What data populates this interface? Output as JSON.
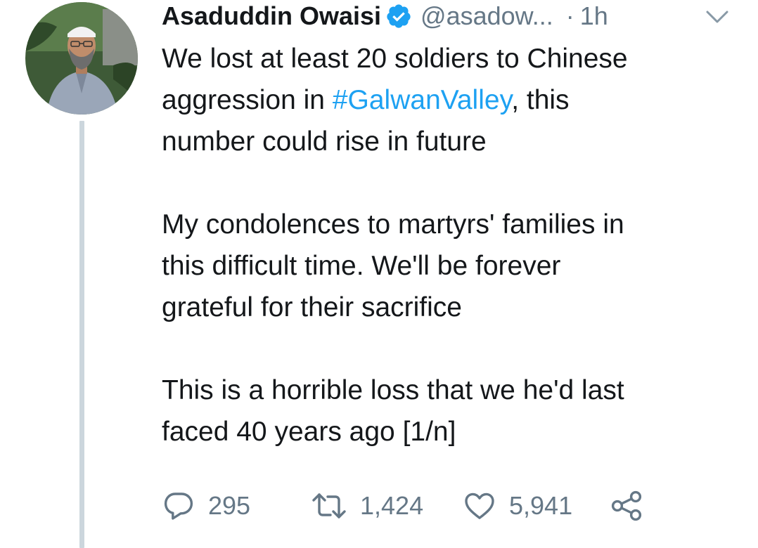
{
  "tweet": {
    "author_name": "Asaduddin Owaisi",
    "handle": "@asadow...",
    "separator": "·",
    "time": "1h",
    "text": {
      "line1": "We lost at least 20 soldiers to Chinese",
      "line2_before": "aggression in ",
      "hashtag": "#GalwanValley",
      "line2_after": ", this",
      "line3": "number could rise in future",
      "line4": "My condolences to martyrs' families in",
      "line5": "this difficult time. We'll be forever",
      "line6": "grateful for their sacrifice",
      "line7": "This is a horrible loss that we he'd last",
      "line8": "faced 40 years ago [1/n]"
    },
    "actions": {
      "replies": "295",
      "retweets": "1,424",
      "likes": "5,941"
    },
    "icons": {
      "verified": "verified-badge-icon",
      "caret": "chevron-down-icon",
      "reply": "reply-icon",
      "retweet": "retweet-icon",
      "like": "heart-icon",
      "share": "share-icon"
    },
    "colors": {
      "accent": "#1da1f2",
      "secondary_text": "#657786",
      "primary_text": "#14171a",
      "thread_line": "#ccd6dd"
    }
  }
}
